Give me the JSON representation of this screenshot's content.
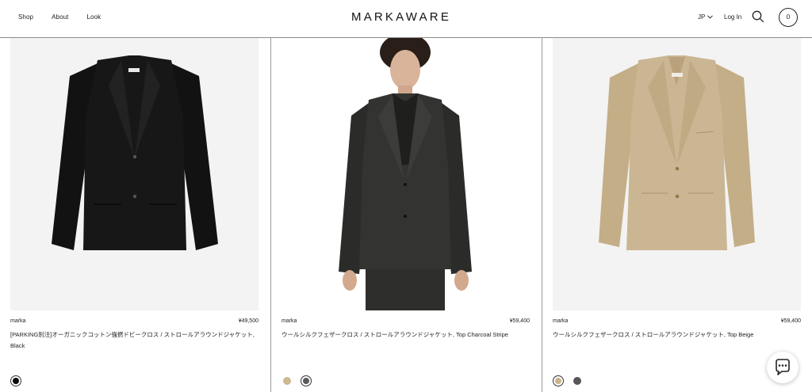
{
  "header": {
    "nav": [
      "Shop",
      "About",
      "Look"
    ],
    "logo": "MARKAWARE",
    "language": "JP",
    "login": "Log In",
    "cart_count": "0"
  },
  "products": [
    {
      "brand": "marka",
      "price": "¥49,500",
      "title": "[PARKING別注]オーガニックコットン強撚ドビークロス / ストロールアラウンドジャケット, Black",
      "swatches": [
        {
          "color": "#0a0a0a",
          "selected": true
        }
      ],
      "garment_color": "#141414"
    },
    {
      "brand": "marka",
      "price": "¥59,400",
      "title": "ウールシルクフェザークロス / ストロールアラウンドジャケット, Top Charcoal Stripe",
      "swatches": [
        {
          "color": "#cdb893",
          "selected": false
        },
        {
          "color": "#5a5a5a",
          "selected": true
        }
      ],
      "garment_color": "#2f302e"
    },
    {
      "brand": "marka",
      "price": "¥59,400",
      "title": "ウールシルクフェザークロス / ストロールアラウンドジャケット, Top Beige",
      "swatches": [
        {
          "color": "#c9b38a",
          "selected": true
        },
        {
          "color": "#575757",
          "selected": false
        }
      ],
      "garment_color": "#c8b48e"
    }
  ]
}
